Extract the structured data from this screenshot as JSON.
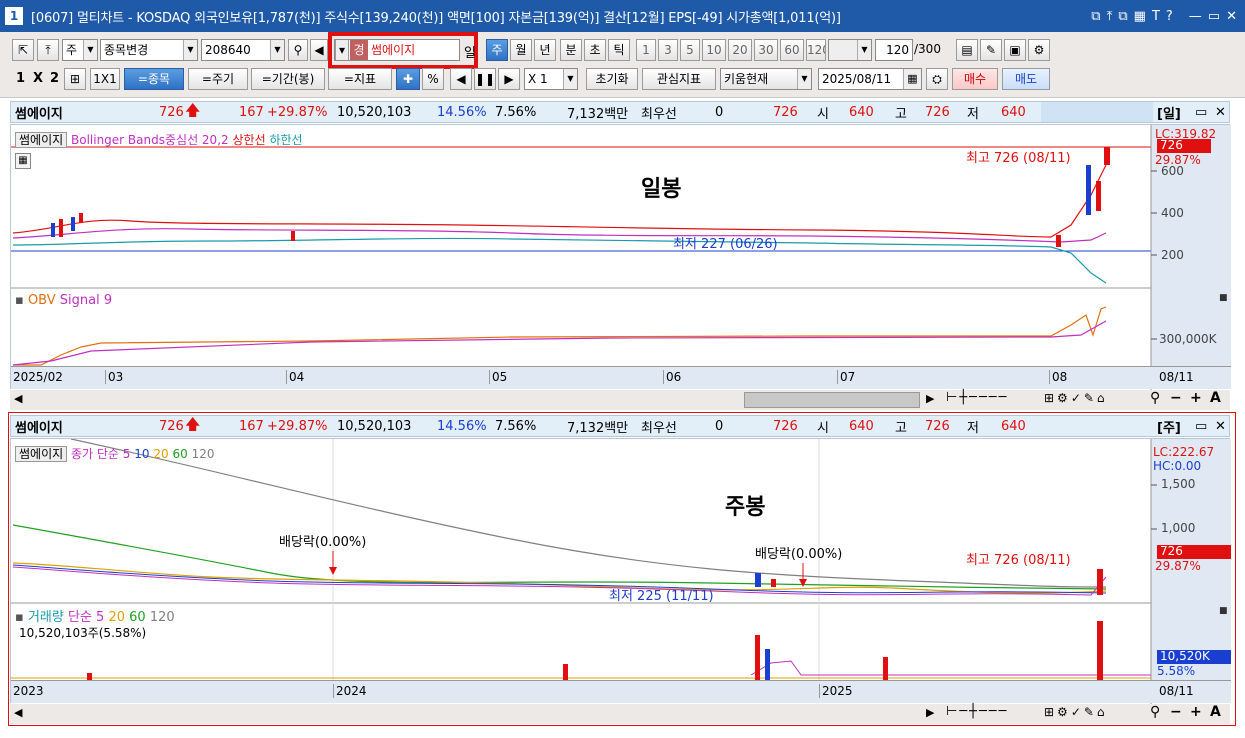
{
  "window": {
    "number": "1",
    "title": "[0607] 멀티차트 - KOSDAQ 외국인보유[1,787(천)] 주식수[139,240(천)] 액면[100] 자본금[139(억)] 결산[12월] EPS[-49] 시가총액[1,011(억)]",
    "controls": [
      "⧉",
      "⤒",
      "⧉",
      "▦",
      "T",
      "?",
      "—",
      "▭",
      "✕"
    ]
  },
  "toolbar1": {
    "period_select": "주",
    "change_select": "종목변경",
    "code_value": "208640",
    "name_prefix": "경",
    "name_value": "썸에이지",
    "period_label": "일",
    "period_buttons": [
      "주",
      "월",
      "년",
      "분",
      "초",
      "틱"
    ],
    "number_buttons": [
      "1",
      "3",
      "5",
      "10",
      "20",
      "30",
      "60",
      "120"
    ],
    "count_value": "120",
    "count_total": "/300"
  },
  "toolbar2": {
    "layout_buttons": [
      "1",
      "X",
      "2"
    ],
    "grid_label": "1X1",
    "btn_stock": "=종목",
    "btn_period": "=주기",
    "btn_range": "=기간(봉)",
    "btn_indicator": "=지표",
    "multiplier": "X 1",
    "btn_reset": "초기화",
    "btn_interest": "관심지표",
    "btn_kiwoom": "키움현재",
    "date_value": "2025/08/11",
    "btn_buy": "매수",
    "btn_sell": "매도"
  },
  "info_top": {
    "name": "썸에이지",
    "price": "726",
    "change": "167",
    "change_pct": "+29.87%",
    "volume": "10,520,103",
    "vol_ratio": "14.56%",
    "turnover": "7.56%",
    "amount": "7,132백만",
    "best_label": "최우선",
    "best_value": "0",
    "last_price": "726",
    "open_label": "시",
    "open": "640",
    "high_label": "고",
    "high": "726",
    "low_label": "저",
    "low": "640",
    "period_tag": "[일]"
  },
  "daily": {
    "legend_name": "썸에이지",
    "legend_bb": "Bollinger Bands중심선 20,2",
    "legend_upper": "상한선",
    "legend_lower": "하한선",
    "big_label": "일봉",
    "max_note": "최고 726 (08/11)",
    "min_note": "최저 227 (06/26)",
    "lc": "LC:319.82",
    "price_tag": "726",
    "pct_tag": "29.87%",
    "y_ticks": [
      "600",
      "400",
      "200"
    ],
    "obv_label": "OBV",
    "obv_signal": "Signal 9",
    "obv_tick": "300,000K",
    "x_labels": [
      "2025/02",
      "03",
      "04",
      "05",
      "06",
      "07",
      "08"
    ],
    "x_end": "08/11"
  },
  "info_bottom": {
    "name": "썸에이지",
    "price": "726",
    "change": "167",
    "change_pct": "+29.87%",
    "volume": "10,520,103",
    "vol_ratio": "14.56%",
    "turnover": "7.56%",
    "amount": "7,132백만",
    "best_label": "최우선",
    "best_value": "0",
    "last_price": "726",
    "open_label": "시",
    "open": "640",
    "high_label": "고",
    "high": "726",
    "low_label": "저",
    "low": "640",
    "period_tag": "[주]"
  },
  "weekly": {
    "legend_name": "썸에이지",
    "legend_ma": "종가 단순 5",
    "ma10": "10",
    "ma20": "20",
    "ma60": "60",
    "ma120": "120",
    "big_label": "주봉",
    "dividend1": "배당락(0.00%)",
    "dividend2": "배당락(0.00%)",
    "max_note": "최고 726 (08/11)",
    "min_note": "최저 225 (11/11)",
    "lc": "LC:222.67",
    "hc": "HC:0.00",
    "y_ticks": [
      "1,500",
      "1,000"
    ],
    "price_tag": "726",
    "pct_tag": "29.87%",
    "vol_label": "거래량",
    "vol_ma": "단순 5",
    "vol20": "20",
    "vol60": "60",
    "vol120": "120",
    "vol_value": "10,520,103주(5.58%)",
    "vol_tag": "10,520K",
    "vol_pct_tag": "5.58%",
    "x_labels": [
      "2023",
      "2024",
      "2025"
    ],
    "x_end": "08/11"
  },
  "colors": {
    "title_blue": "#1e5aa8",
    "up_red": "#e01010",
    "down_blue": "#1a3fd0",
    "bb_magenta": "#c030c0",
    "lower_teal": "#1a9aaa",
    "obv_orange": "#e07010",
    "highlight": "#e01010"
  }
}
